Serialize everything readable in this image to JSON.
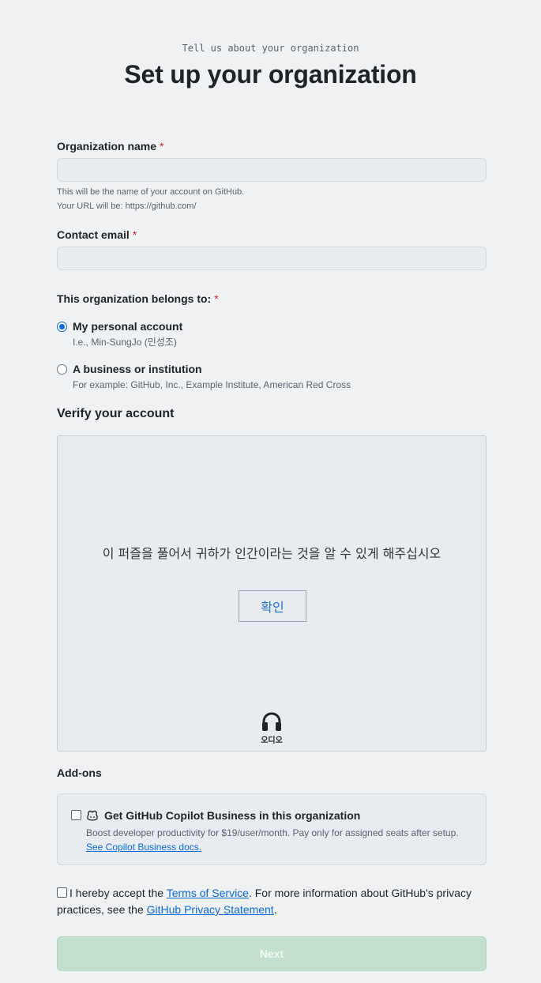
{
  "header": {
    "subtitle": "Tell us about your organization",
    "title": "Set up your organization"
  },
  "org_name": {
    "label": "Organization name",
    "required_mark": "*",
    "value": "",
    "hint_line1": "This will be the name of your account on GitHub.",
    "hint_line2": "Your URL will be: https://github.com/"
  },
  "contact_email": {
    "label": "Contact email",
    "required_mark": "*",
    "value": ""
  },
  "belongs_to": {
    "label": "This organization belongs to:",
    "required_mark": "*",
    "options": [
      {
        "label": "My personal account",
        "desc": "I.e., Min-SungJo (민성조)",
        "checked": true
      },
      {
        "label": "A business or institution",
        "desc": "For example: GitHub, Inc., Example Institute, American Red Cross",
        "checked": false
      }
    ]
  },
  "verify": {
    "heading": "Verify your account",
    "prompt": "이 퍼즐을 풀어서 귀하가 인간이라는 것을 알 수 있게 해주십시오",
    "button": "확인",
    "audio_label": "오디오"
  },
  "addons": {
    "heading": "Add-ons",
    "copilot_title": "Get GitHub Copilot Business in this organization",
    "copilot_desc": "Boost developer productivity for $19/user/month. Pay only for assigned seats after setup.",
    "copilot_link": "See Copilot Business docs."
  },
  "terms": {
    "prefix": "I hereby accept the ",
    "tos_link": "Terms of Service",
    "middle": ". For more information about GitHub's privacy practices, see the ",
    "privacy_link": "GitHub Privacy Statement",
    "suffix": "."
  },
  "next_button": "Next",
  "colors": {
    "page_bg": "#eff1f3",
    "accent_blue": "#0969da",
    "required_red": "#d1242f",
    "disabled_green": "#c2e0cd"
  }
}
